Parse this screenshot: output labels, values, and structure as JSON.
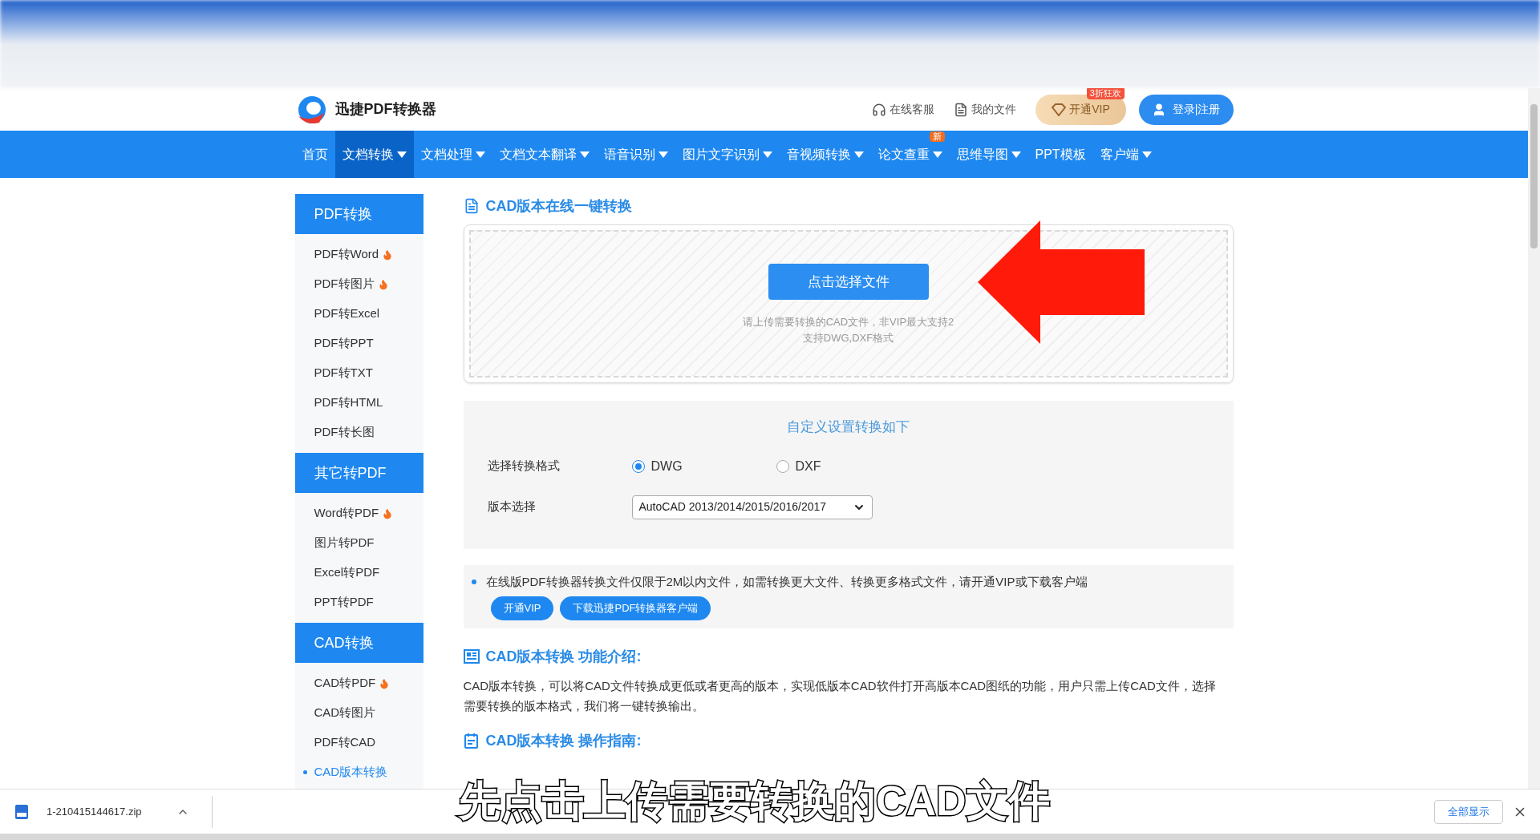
{
  "header": {
    "logo_text": "迅捷PDF转换器",
    "links": [
      {
        "kind": "service",
        "label": "在线客服"
      },
      {
        "kind": "files",
        "label": "我的文件"
      }
    ],
    "vip_button": {
      "label": "开通VIP",
      "badge": "3折狂欢"
    },
    "login_button": {
      "label": "登录|注册"
    }
  },
  "nav": [
    {
      "label": "首页",
      "selected": false,
      "dropdown": false
    },
    {
      "label": "文档转换",
      "selected": true,
      "dropdown": true
    },
    {
      "label": "文档处理",
      "selected": false,
      "dropdown": true
    },
    {
      "label": "文档文本翻译",
      "selected": false,
      "dropdown": true
    },
    {
      "label": "语音识别",
      "selected": false,
      "dropdown": true
    },
    {
      "label": "图片文字识别",
      "selected": false,
      "dropdown": true
    },
    {
      "label": "音视频转换",
      "selected": false,
      "dropdown": true
    },
    {
      "label": "论文查重",
      "selected": false,
      "dropdown": true,
      "badge": "新"
    },
    {
      "label": "思维导图",
      "selected": false,
      "dropdown": true
    },
    {
      "label": "PPT模板",
      "selected": false,
      "dropdown": false
    },
    {
      "label": "客户端",
      "selected": false,
      "dropdown": true
    }
  ],
  "sidebar": [
    {
      "title": "PDF转换",
      "items": [
        {
          "label": "PDF转Word",
          "hot": true,
          "selected": false
        },
        {
          "label": "PDF转图片",
          "hot": true,
          "selected": false
        },
        {
          "label": "PDF转Excel",
          "hot": false,
          "selected": false
        },
        {
          "label": "PDF转PPT",
          "hot": false,
          "selected": false
        },
        {
          "label": "PDF转TXT",
          "hot": false,
          "selected": false
        },
        {
          "label": "PDF转HTML",
          "hot": false,
          "selected": false
        },
        {
          "label": "PDF转长图",
          "hot": false,
          "selected": false
        }
      ]
    },
    {
      "title": "其它转PDF",
      "items": [
        {
          "label": "Word转PDF",
          "hot": true,
          "selected": false
        },
        {
          "label": "图片转PDF",
          "hot": false,
          "selected": false
        },
        {
          "label": "Excel转PDF",
          "hot": false,
          "selected": false
        },
        {
          "label": "PPT转PDF",
          "hot": false,
          "selected": false
        }
      ]
    },
    {
      "title": "CAD转换",
      "items": [
        {
          "label": "CAD转PDF",
          "hot": true,
          "selected": false
        },
        {
          "label": "CAD转图片",
          "hot": false,
          "selected": false
        },
        {
          "label": "PDF转CAD",
          "hot": false,
          "selected": false
        },
        {
          "label": "CAD版本转换",
          "hot": false,
          "selected": true
        }
      ]
    }
  ],
  "main": {
    "title": "CAD版本在线一键转换",
    "upload": {
      "button": "点击选择文件",
      "hint_1": "请上传需要转换的CAD文件，非VIP最大支持2",
      "hint_2": "支持DWG,DXF格式"
    },
    "settings": {
      "title": "自定义设置转换如下",
      "format_label": "选择转换格式",
      "formats": [
        {
          "label": "DWG",
          "selected": true
        },
        {
          "label": "DXF",
          "selected": false
        }
      ],
      "version_label": "版本选择",
      "version_value": "AutoCAD 2013/2014/2015/2016/2017"
    },
    "notice": {
      "text": "在线版PDF转换器转换文件仅限于2M以内文件，如需转换更大文件、转换更多格式文件，请开通VIP或下载客户端",
      "buttons": [
        "开通VIP",
        "下载迅捷PDF转换器客户端"
      ]
    },
    "intro": {
      "title": "CAD版本转换 功能介绍:",
      "text": "CAD版本转换，可以将CAD文件转换成更低或者更高的版本，实现低版本CAD软件打开高版本CAD图纸的功能，用户只需上传CAD文件，选择需要转换的版本格式，我们将一键转换输出。"
    },
    "guide": {
      "title": "CAD版本转换 操作指南:"
    }
  },
  "download_bar": {
    "file": "1-210415144617.zip",
    "show_all": "全部显示"
  },
  "subtitle": "先点击上传需要转换的CAD文件"
}
